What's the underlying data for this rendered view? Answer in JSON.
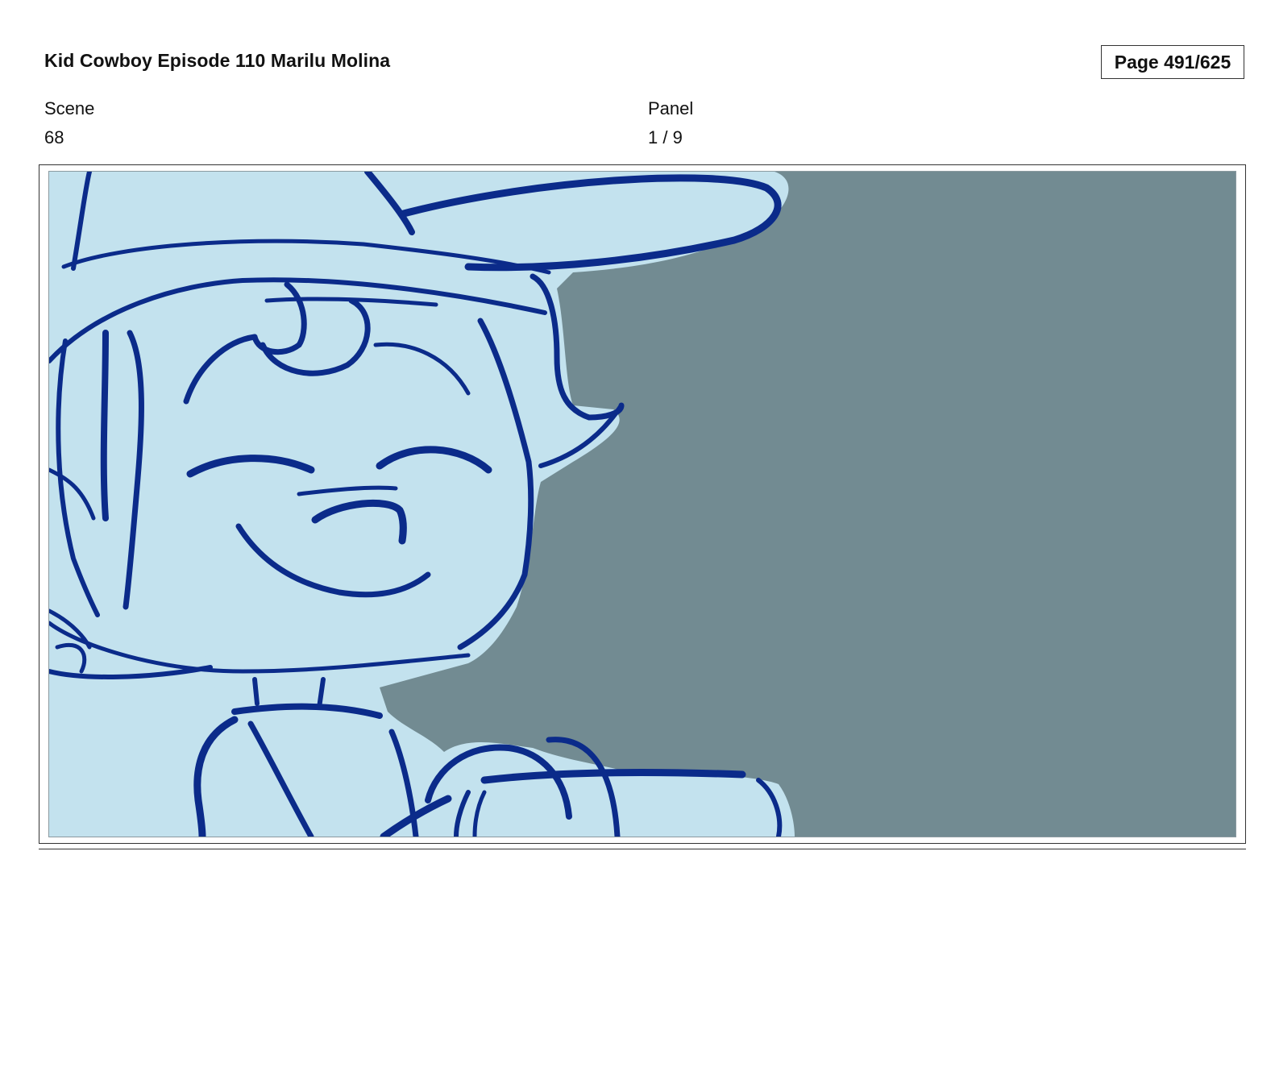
{
  "header": {
    "title": "Kid Cowboy Episode 110 Marilu Molina",
    "page_label": "Page 491/625"
  },
  "fields": {
    "scene_label": "Scene",
    "scene_value": "68",
    "panel_label": "Panel",
    "panel_value": "1 / 9"
  },
  "panel_image": {
    "description_icon": "storyboard-sketch",
    "colors": {
      "background": "#728b92",
      "fill": "#c3e2ee",
      "line": "#0b2b8a"
    }
  }
}
